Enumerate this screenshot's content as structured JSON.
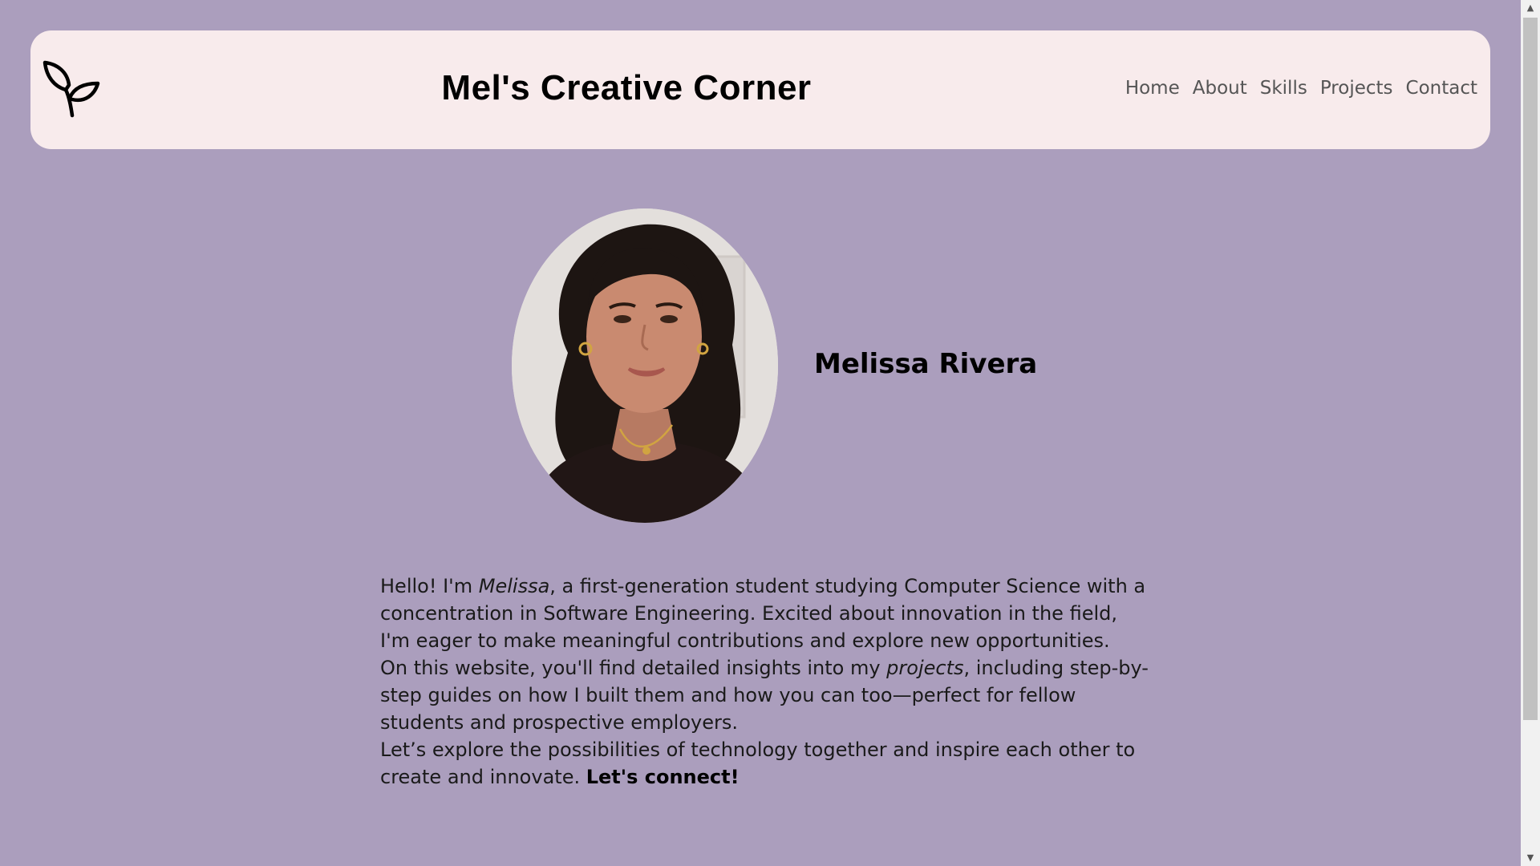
{
  "header": {
    "logo_icon": "sprout-icon",
    "site_title": "Mel's Creative Corner",
    "nav": [
      {
        "label": "Home"
      },
      {
        "label": "About"
      },
      {
        "label": "Skills"
      },
      {
        "label": "Projects"
      },
      {
        "label": "Contact"
      }
    ]
  },
  "profile": {
    "photo_icon": "profile-photo",
    "name": "Melissa Rivera"
  },
  "bio": {
    "p1_pre": "Hello! I'm ",
    "p1_em": "Melissa",
    "p1_post": ", a first-generation student studying Computer Science with a concentration in Software Engineering. Excited about innovation in the field, I'm eager to make meaningful contributions and explore new opportunities.",
    "p2_pre": "On this website, you'll find detailed insights into my ",
    "p2_em": "projects",
    "p2_post": ", including step-by-step guides on how I built them and how you can too—perfect for fellow students and prospective employers.",
    "p3_pre": "Let’s explore the possibilities of technology together and inspire each other to create and innovate. ",
    "p3_strong": "Let's connect!"
  },
  "colors": {
    "page_background": "#ab9ebd",
    "header_background": "#f8ebec",
    "nav_text": "#555555",
    "title_text": "#000000"
  }
}
